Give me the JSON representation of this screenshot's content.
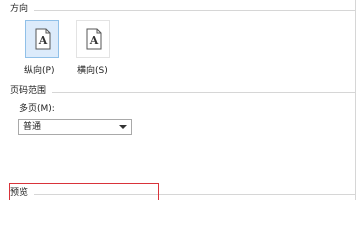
{
  "orientation": {
    "section_title": "方向",
    "options": [
      {
        "label": "纵向(P)",
        "selected": true,
        "icon": "portrait-page-icon",
        "glyph": "A"
      },
      {
        "label": "横向(S)",
        "selected": false,
        "icon": "landscape-page-icon",
        "glyph": "A"
      }
    ]
  },
  "page_range": {
    "section_title": "页码范围",
    "multiple_pages_label": "多页(M):",
    "multiple_pages_value": "普通"
  },
  "preview": {
    "section_title": "预览"
  },
  "colors": {
    "selected_fill": "#dcebfb",
    "selected_border": "#90c0e8",
    "highlight_border": "#d9333a",
    "divider": "#d6d6d6"
  }
}
